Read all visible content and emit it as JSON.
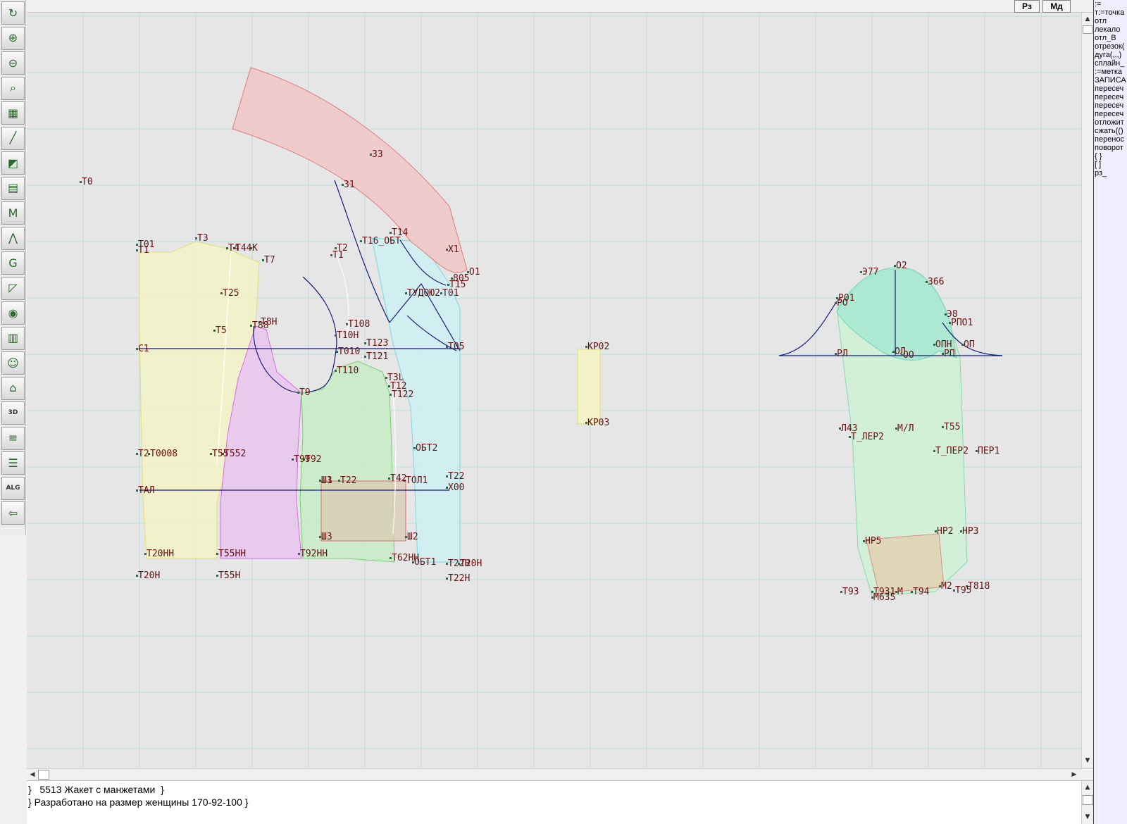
{
  "toolbar": {
    "tools": [
      {
        "icon": "refresh-icon",
        "glyph": "↻"
      },
      {
        "icon": "zoom-in-icon",
        "glyph": "⊕"
      },
      {
        "icon": "zoom-out-icon",
        "glyph": "⊖"
      },
      {
        "icon": "zoom-fit-icon",
        "glyph": "⌕"
      },
      {
        "icon": "grid-icon",
        "glyph": "▦"
      },
      {
        "icon": "line-icon",
        "glyph": "╱"
      },
      {
        "icon": "piece-icon",
        "glyph": "◩"
      },
      {
        "icon": "pattern-icon",
        "glyph": "▤"
      },
      {
        "icon": "model-icon",
        "glyph": "M"
      },
      {
        "icon": "compass-icon",
        "glyph": "⋀"
      },
      {
        "icon": "grading-icon",
        "glyph": "G"
      },
      {
        "icon": "ruler-icon",
        "glyph": "◸"
      },
      {
        "icon": "camera-icon",
        "glyph": "◉"
      },
      {
        "icon": "table-icon",
        "glyph": "▥"
      },
      {
        "icon": "avatar-icon",
        "glyph": "☺"
      },
      {
        "icon": "jacket-icon",
        "glyph": "⌂"
      },
      {
        "icon": "3d-icon",
        "glyph": "3D"
      },
      {
        "icon": "document-icon",
        "glyph": "≡"
      },
      {
        "icon": "layers-icon",
        "glyph": "☰"
      },
      {
        "icon": "algorithm-icon",
        "glyph": "ALG"
      },
      {
        "icon": "exit-icon",
        "glyph": "⇦"
      }
    ]
  },
  "topbar": {
    "sizes_button": "Рз",
    "models_button": "Мд"
  },
  "commands": [
    ":=",
    "т:=точка",
    "отл",
    "лекало",
    "отл_В",
    "отрезок(",
    "дуга(,,,)",
    "сплайн_",
    ":=метка",
    "ЗАПИСА",
    "пересеч",
    "пересеч",
    "пересеч",
    "пересеч",
    "отложит",
    "сжать(()",
    "перенос",
    "поворот",
    "{ }",
    "[ ]",
    "рз_"
  ],
  "console": {
    "line1": "}   5513 Жакет с манжетами  }",
    "line2": "} Разработано на размер женщины 170-92-100 }"
  },
  "canvas": {
    "labels": [
      "Т0",
      "Т01",
      "Т1",
      "Т3",
      "Т4",
      "Т44",
      "К",
      "Т7",
      "Т25",
      "Т5",
      "Т88",
      "Т8Н",
      "С1",
      "Т2",
      "Т0008",
      "Т55",
      "Т552",
      "Т99",
      "Т92",
      "ТАЛ",
      "Т20НН",
      "Т55НН",
      "Т92НН",
      "Т20Н",
      "Т55Н",
      "Т9",
      "33",
      "31",
      "Т16_ОБТ",
      "Т14",
      "Х1",
      "Т2",
      "Т1",
      "Т108",
      "Т10Н",
      "Т010",
      "Т123",
      "Т121",
      "Т110",
      "Т3L",
      "Т12",
      "Т122",
      "ТУДОЮ2",
      "Т15",
      "Т01",
      "805",
      "О1",
      "Т05",
      "Ш3",
      "ОБТ2",
      "Т22",
      "Х00",
      "Ш1",
      "Т22",
      "Т42",
      "ТОЛ1",
      "ШЗ",
      "Ш2",
      "Т62НН",
      "ОБТ1",
      "Т22Н",
      "Т20Н",
      "Т22Н",
      "КР02",
      "КР03",
      "Э77",
      "О2",
      "З66",
      "Р01",
      "РО",
      "Э8",
      "РПО1",
      "РЛ",
      "ОЛ",
      "ОО",
      "ОПН",
      "ОП",
      "РП",
      "Л43",
      "Т_ЛЕР2",
      "М/Л",
      "Т55",
      "Т_ПЕР2",
      "ПЕР1",
      "НР5",
      "НР2",
      "НР3",
      "Т93",
      "Т931",
      "М",
      "Т94",
      "М2",
      "Т95",
      "Т818",
      "М6З5"
    ]
  }
}
